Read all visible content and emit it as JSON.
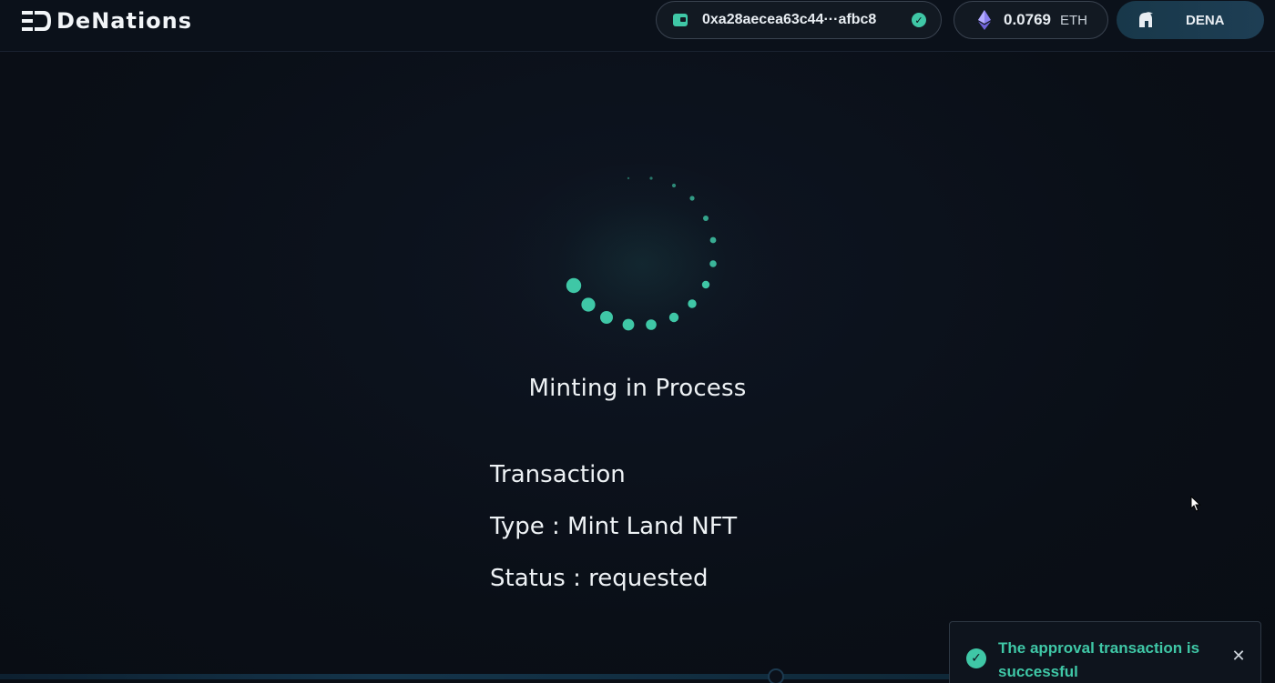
{
  "header": {
    "logo_text": "DeNations",
    "wallet": {
      "address": "0xa28aecea63c44···afbc8",
      "verified": true
    },
    "balance": {
      "value": "0.0769",
      "unit": "ETH"
    },
    "token_button": {
      "label": "DENA"
    }
  },
  "main": {
    "status_title": "Minting in Process",
    "transaction": {
      "heading": "Transaction",
      "type_line": "Type : Mint Land NFT",
      "status_line": "Status : requested"
    }
  },
  "toast": {
    "message": "The approval transaction is successful",
    "close_symbol": "✕",
    "check_symbol": "✓"
  },
  "colors": {
    "accent": "#3fc7a6",
    "background": "#0b1019",
    "eth_purple": "#8a7ff0"
  },
  "icons": {
    "wallet": "wallet-icon",
    "verified": "check-circle-icon",
    "eth": "ethereum-icon",
    "token": "spartan-helmet-icon",
    "toast": "check-circle-icon",
    "close": "close-icon"
  }
}
